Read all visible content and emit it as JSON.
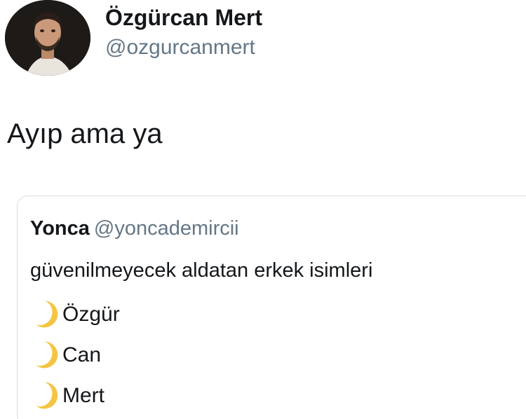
{
  "author": {
    "display_name": "Özgürcan Mert",
    "handle": "@ozgurcanmert"
  },
  "tweet": {
    "text": "Ayıp ama ya"
  },
  "quoted_tweet": {
    "display_name": "Yonca",
    "handle": "@yoncademircii",
    "text": "güvenilmeyecek aldatan erkek isimleri",
    "list_items": [
      {
        "icon": "crescent-moon-icon",
        "label": "Özgür"
      },
      {
        "icon": "crescent-moon-icon",
        "label": "Can"
      },
      {
        "icon": "crescent-moon-icon",
        "label": "Mert"
      }
    ]
  },
  "colors": {
    "text_primary": "#14171a",
    "text_secondary": "#657786",
    "border": "#d8dde1",
    "moon": "#f4c542"
  }
}
